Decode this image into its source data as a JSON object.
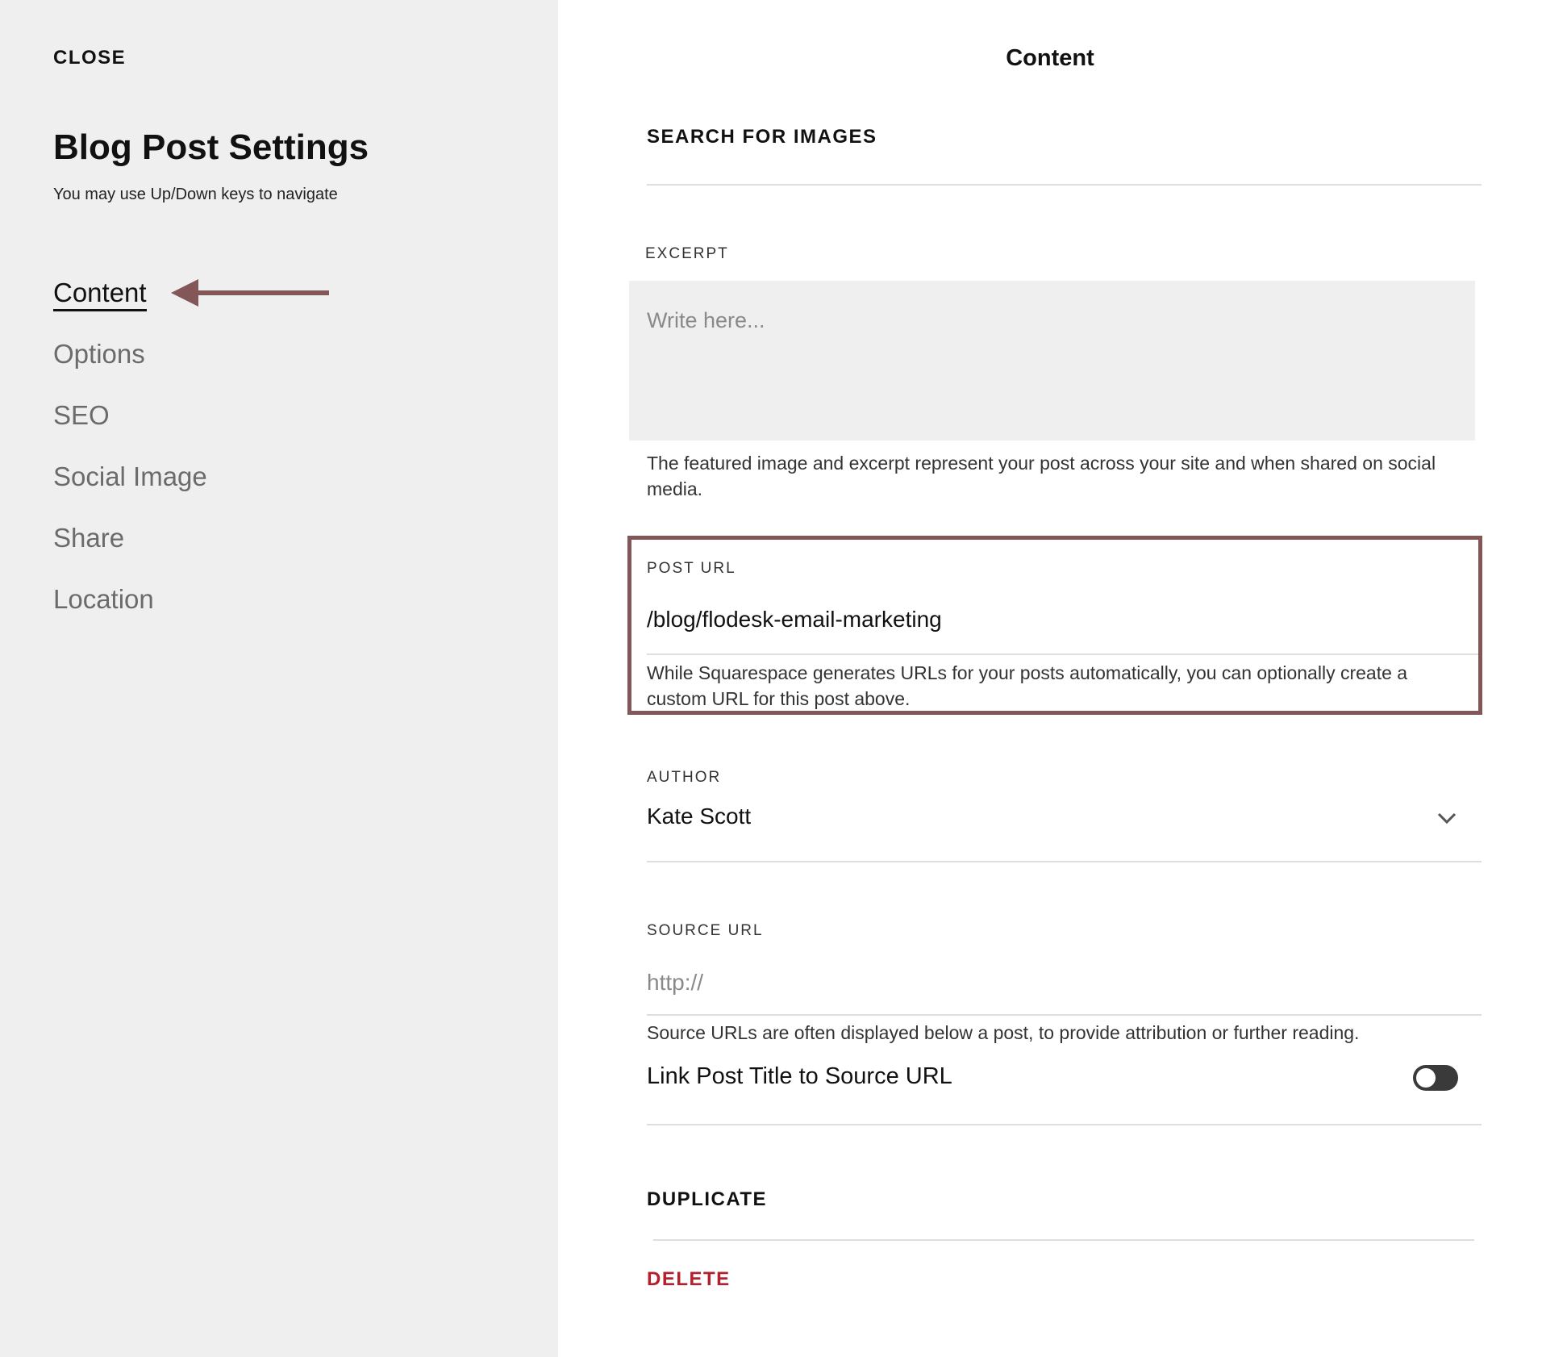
{
  "sidebar": {
    "close_label": "CLOSE",
    "title": "Blog Post Settings",
    "hint": "You may use Up/Down keys to navigate",
    "items": [
      {
        "label": "Content",
        "active": true
      },
      {
        "label": "Options",
        "active": false
      },
      {
        "label": "SEO",
        "active": false
      },
      {
        "label": "Social Image",
        "active": false
      },
      {
        "label": "Share",
        "active": false
      },
      {
        "label": "Location",
        "active": false
      }
    ]
  },
  "panel": {
    "title": "Content",
    "search_images_label": "SEARCH FOR IMAGES",
    "excerpt": {
      "label": "EXCERPT",
      "placeholder": "Write here...",
      "value": "",
      "help": "The featured image and excerpt represent your post across your site and when shared on social media."
    },
    "post_url": {
      "label": "POST URL",
      "value": "/blog/flodesk-email-marketing",
      "help": "While Squarespace generates URLs for your posts automatically, you can optionally create a custom URL for this post above."
    },
    "author": {
      "label": "AUTHOR",
      "value": "Kate Scott"
    },
    "source_url": {
      "label": "SOURCE URL",
      "placeholder": "http://",
      "value": "",
      "help": "Source URLs are often displayed below a post, to provide attribution or further reading."
    },
    "link_title_toggle": {
      "label": "Link Post Title to Source URL",
      "on": false
    },
    "duplicate_label": "DUPLICATE",
    "delete_label": "DELETE"
  },
  "colors": {
    "annotation": "#835757",
    "delete": "#b3202e",
    "sidebar_bg": "#efefef"
  },
  "icons": {
    "annotation_arrow": "arrow-left-icon",
    "author_select": "chevron-down-icon"
  }
}
